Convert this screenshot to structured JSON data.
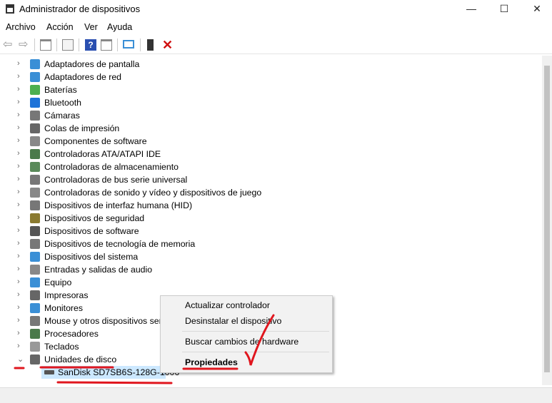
{
  "window": {
    "title": "Administrador de dispositivos",
    "minimize": "—",
    "maximize": "☐",
    "close": "✕"
  },
  "menu": [
    "Archivo",
    "Acción",
    "Ver",
    "Ayuda"
  ],
  "toolbar": {
    "icons": [
      "back-icon",
      "forward-icon",
      "console-tree-icon",
      "properties-icon",
      "help-icon",
      "action-pane-icon",
      "scan-hardware-icon",
      "update-driver-icon",
      "uninstall-icon"
    ]
  },
  "tree": {
    "categories": [
      {
        "label": "Adaptadores de pantalla",
        "color": "#3a8fd6"
      },
      {
        "label": "Adaptadores de red",
        "color": "#3a8fd6"
      },
      {
        "label": "Baterías",
        "color": "#4caf50"
      },
      {
        "label": "Bluetooth",
        "color": "#1e73d8"
      },
      {
        "label": "Cámaras",
        "color": "#777777"
      },
      {
        "label": "Colas de impresión",
        "color": "#666666"
      },
      {
        "label": "Componentes de software",
        "color": "#888888"
      },
      {
        "label": "Controladoras ATA/ATAPI IDE",
        "color": "#4a7a4a"
      },
      {
        "label": "Controladoras de almacenamiento",
        "color": "#5a8a5a"
      },
      {
        "label": "Controladoras de bus serie universal",
        "color": "#777777"
      },
      {
        "label": "Controladoras de sonido y vídeo y dispositivos de juego",
        "color": "#888888"
      },
      {
        "label": "Dispositivos de interfaz humana (HID)",
        "color": "#777777"
      },
      {
        "label": "Dispositivos de seguridad",
        "color": "#8a7a30"
      },
      {
        "label": "Dispositivos de software",
        "color": "#555555"
      },
      {
        "label": "Dispositivos de tecnología de memoria",
        "color": "#777777"
      },
      {
        "label": "Dispositivos del sistema",
        "color": "#3a8fd6"
      },
      {
        "label": "Entradas y salidas de audio",
        "color": "#888888"
      },
      {
        "label": "Equipo",
        "color": "#3a8fd6"
      },
      {
        "label": "Impresoras",
        "color": "#666666"
      },
      {
        "label": "Monitores",
        "color": "#3a8fd6"
      },
      {
        "label": "Mouse y otros dispositivos señ",
        "color": "#777777"
      },
      {
        "label": "Procesadores",
        "color": "#4a7a4a"
      },
      {
        "label": "Teclados",
        "color": "#999999"
      },
      {
        "label": "Unidades de disco",
        "color": "#666666",
        "expanded": true
      }
    ],
    "child": {
      "label": "SanDisk SD7SB6S-128G-1006",
      "selected": true
    }
  },
  "context_menu": {
    "items": [
      "Actualizar controlador",
      "Desinstalar el dispositivo",
      "Buscar cambios de hardware",
      "Propiedades"
    ]
  },
  "colors": {
    "annotation": "#e0161e",
    "selection": "#cce8ff"
  }
}
